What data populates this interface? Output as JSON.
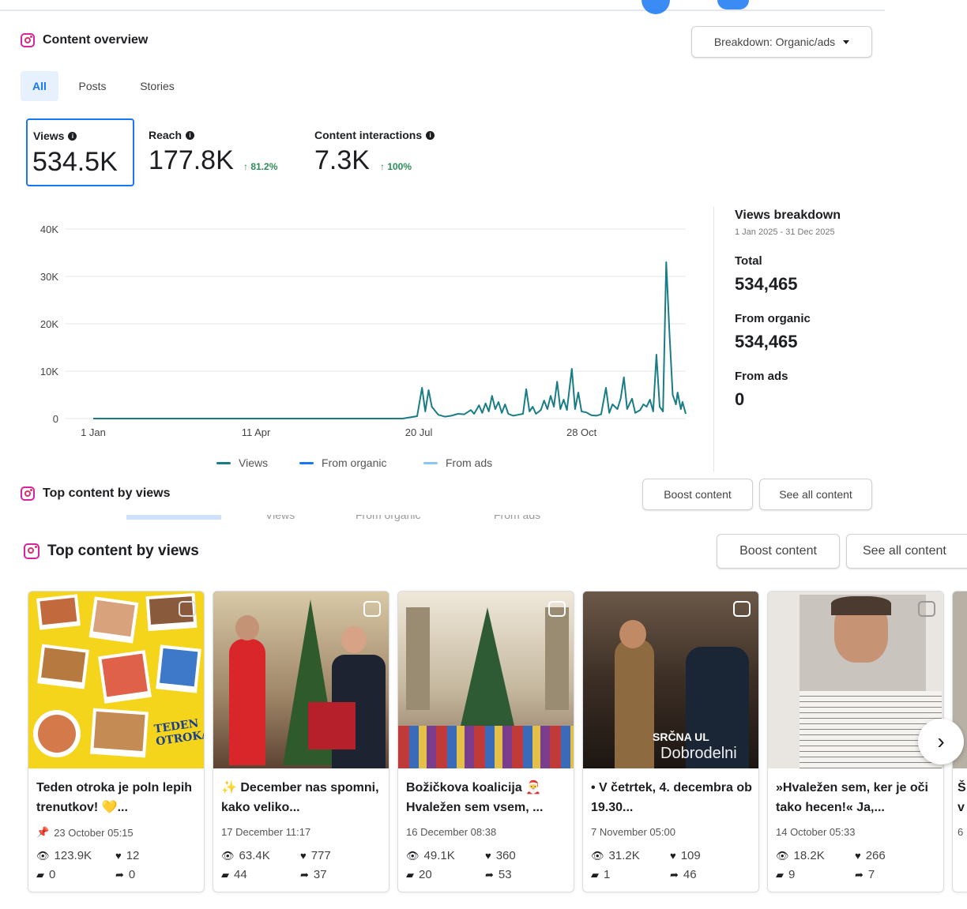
{
  "overview": {
    "title": "Content overview",
    "breakdown_select": "Breakdown: Organic/ads",
    "tabs": [
      "All",
      "Posts",
      "Stories"
    ],
    "active_tab": "All",
    "metrics": [
      {
        "label": "Views",
        "value": "534.5K",
        "change": ""
      },
      {
        "label": "Reach",
        "value": "177.8K",
        "change": "↑ 81.2%"
      },
      {
        "label": "Content interactions",
        "value": "7.3K",
        "change": "↑ 100%"
      }
    ]
  },
  "chart_data": {
    "type": "line",
    "y_ticks": [
      "40K",
      "30K",
      "20K",
      "10K",
      "0"
    ],
    "x_ticks": [
      "1 Jan",
      "11 Apr",
      "20 Jul",
      "28 Oct"
    ],
    "ylim": [
      0,
      40000
    ],
    "x_domain_days": [
      0,
      364
    ],
    "series": [
      {
        "name": "Views",
        "color": "#1a7d85",
        "points": [
          [
            0,
            0
          ],
          [
            60,
            0
          ],
          [
            120,
            0
          ],
          [
            180,
            0
          ],
          [
            190,
            0
          ],
          [
            199,
            500
          ],
          [
            202,
            6500
          ],
          [
            204,
            1500
          ],
          [
            206,
            6000
          ],
          [
            208,
            2500
          ],
          [
            212,
            800
          ],
          [
            216,
            400
          ],
          [
            220,
            600
          ],
          [
            224,
            1000
          ],
          [
            228,
            900
          ],
          [
            232,
            1800
          ],
          [
            234,
            1000
          ],
          [
            237,
            2800
          ],
          [
            239,
            1200
          ],
          [
            241,
            3200
          ],
          [
            243,
            1500
          ],
          [
            245,
            4800
          ],
          [
            247,
            2000
          ],
          [
            249,
            3500
          ],
          [
            251,
            1200
          ],
          [
            253,
            3000
          ],
          [
            255,
            1000
          ],
          [
            258,
            600
          ],
          [
            261,
            800
          ],
          [
            264,
            1000
          ],
          [
            266,
            6200
          ],
          [
            268,
            1500
          ],
          [
            270,
            2500
          ],
          [
            272,
            1000
          ],
          [
            275,
            1800
          ],
          [
            277,
            3800
          ],
          [
            279,
            2000
          ],
          [
            281,
            4800
          ],
          [
            283,
            2500
          ],
          [
            285,
            7800
          ],
          [
            287,
            2000
          ],
          [
            289,
            4000
          ],
          [
            291,
            1800
          ],
          [
            294,
            10500
          ],
          [
            296,
            2000
          ],
          [
            298,
            5500
          ],
          [
            300,
            1500
          ],
          [
            303,
            1300
          ],
          [
            306,
            700
          ],
          [
            309,
            600
          ],
          [
            312,
            900
          ],
          [
            315,
            6500
          ],
          [
            317,
            1200
          ],
          [
            319,
            3000
          ],
          [
            322,
            2000
          ],
          [
            324,
            4200
          ],
          [
            326,
            8700
          ],
          [
            328,
            2000
          ],
          [
            331,
            4200
          ],
          [
            333,
            1200
          ],
          [
            336,
            1800
          ],
          [
            338,
            3000
          ],
          [
            340,
            2500
          ],
          [
            342,
            4000
          ],
          [
            344,
            1500
          ],
          [
            346,
            13500
          ],
          [
            348,
            2500
          ],
          [
            350,
            1500
          ],
          [
            352,
            33000
          ],
          [
            354,
            18000
          ],
          [
            356,
            5000
          ],
          [
            358,
            3000
          ],
          [
            359,
            5500
          ],
          [
            361,
            2000
          ],
          [
            362,
            3500
          ],
          [
            364,
            1000
          ]
        ]
      },
      {
        "name": "From organic",
        "color": "#1877f2",
        "points": []
      },
      {
        "name": "From ads",
        "color": "#8ec5f5",
        "points": []
      }
    ]
  },
  "views_breakdown": {
    "title": "Views breakdown",
    "range": "1 Jan 2025 - 31 Dec 2025",
    "total_label": "Total",
    "total_value": "534,465",
    "organic_label": "From organic",
    "organic_value": "534,465",
    "ads_label": "From ads",
    "ads_value": "0"
  },
  "top_content": {
    "title": "Top content by views",
    "boost_label": "Boost content",
    "see_all_label": "See all content",
    "legend_ghost": [
      "Views",
      "From organic",
      "From ads"
    ],
    "cards": [
      {
        "caption": "Teden otroka je poln lepih trenutkov! 💛...",
        "date": "23 October 05:15",
        "pinned": true,
        "views": "123.9K",
        "likes": "12",
        "comments": "0",
        "shares": "0"
      },
      {
        "caption": "✨ December nas spomni, kako veliko...",
        "date": "17 December 11:17",
        "pinned": false,
        "views": "63.4K",
        "likes": "777",
        "comments": "44",
        "shares": "37"
      },
      {
        "caption": "Božičkova koalicija 🎅 Hvaležen sem vsem, ...",
        "date": "16 December 08:38",
        "pinned": false,
        "views": "49.1K",
        "likes": "360",
        "comments": "20",
        "shares": "53"
      },
      {
        "caption": "• V četrtek, 4. decembra ob 19.30...",
        "date": "7 November 05:00",
        "pinned": false,
        "views": "31.2K",
        "likes": "109",
        "comments": "1",
        "shares": "46"
      },
      {
        "caption": "»Hvaležen sem, ker je oči tako hecen!« Ja,...",
        "date": "14 October 05:33",
        "pinned": false,
        "views": "18.2K",
        "likes": "266",
        "comments": "9",
        "shares": "7"
      },
      {
        "caption": "Š v",
        "date": "6",
        "pinned": false,
        "views": "",
        "likes": "",
        "comments": "",
        "shares": ""
      }
    ],
    "thumb_text": {
      "card1": "TEDEN OTROKA",
      "card4_a": "SRČNA UL",
      "card4_b": "Dobrodelni"
    }
  }
}
